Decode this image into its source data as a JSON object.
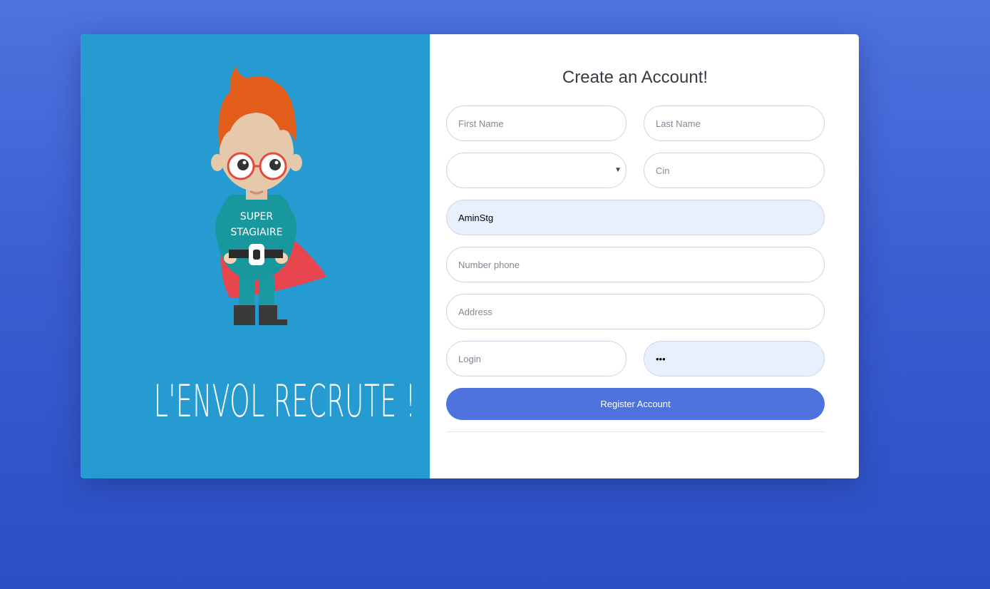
{
  "hero": {
    "shirt_line1": "SUPER",
    "shirt_line2": "STAGIAIRE",
    "slogan": "L'ENVOL RECRUTE !"
  },
  "form": {
    "title": "Create an Account!",
    "first_name": {
      "placeholder": "First Name",
      "value": ""
    },
    "last_name": {
      "placeholder": "Last Name",
      "value": ""
    },
    "select": {
      "selected": ""
    },
    "cin": {
      "placeholder": "Cin",
      "value": ""
    },
    "username": {
      "value": "AminStg"
    },
    "phone": {
      "placeholder": "Number phone",
      "value": ""
    },
    "address": {
      "placeholder": "Address",
      "value": ""
    },
    "login": {
      "placeholder": "Login",
      "value": ""
    },
    "password": {
      "value": "•••"
    },
    "submit_label": "Register Account"
  },
  "colors": {
    "background": "#4e73df",
    "left_panel": "#259bd2",
    "button": "#4e73df",
    "autofill": "#e8f0fe"
  }
}
